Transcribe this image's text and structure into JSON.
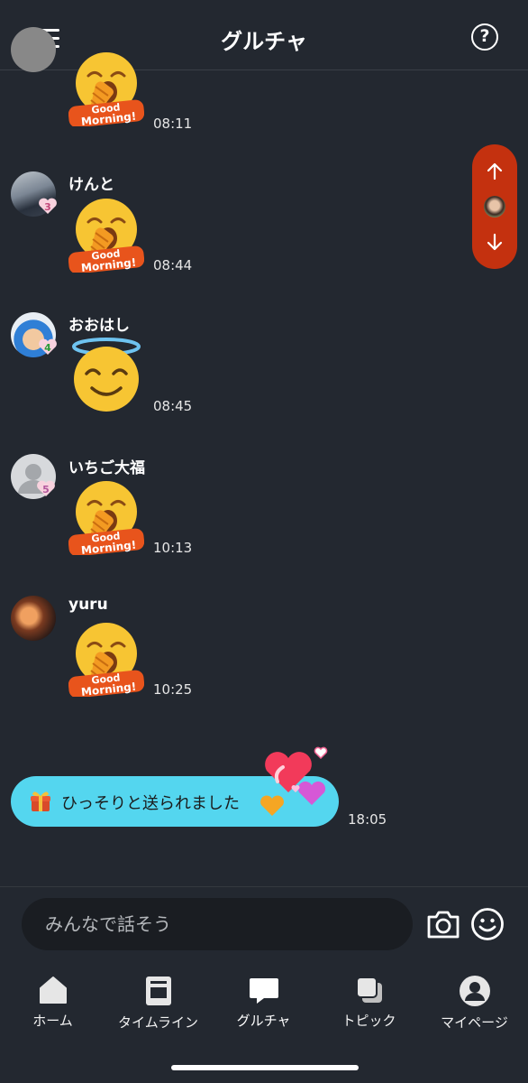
{
  "header": {
    "title": "グルチャ",
    "help_glyph": "?",
    "menu_icon": "hamburger-icon"
  },
  "messages": [
    {
      "user": "",
      "sticker": "good-morning-yawn",
      "sticker_text": "Good Morning!",
      "time": "08:11"
    },
    {
      "user": "けんと",
      "badge": "3",
      "sticker": "good-morning-yawn",
      "sticker_text": "Good Morning!",
      "time": "08:44"
    },
    {
      "user": "おおはし",
      "badge": "4",
      "sticker": "halo-smile",
      "time": "08:45"
    },
    {
      "user": "いちご大福",
      "badge": "5",
      "sticker": "good-morning-yawn",
      "sticker_text": "Good Morning!",
      "time": "10:13"
    },
    {
      "user": "yuru",
      "sticker": "good-morning-yawn",
      "sticker_text": "Good Morning!",
      "time": "10:25"
    }
  ],
  "gift_message": {
    "text": "ひっそりと送られました",
    "time": "18:05"
  },
  "input": {
    "placeholder": "みんなで話そう"
  },
  "tabs": [
    {
      "label": "ホーム",
      "icon": "home-icon"
    },
    {
      "label": "タイムライン",
      "icon": "timeline-icon"
    },
    {
      "label": "グルチャ",
      "icon": "chat-bubble-icon",
      "active": true
    },
    {
      "label": "トピック",
      "icon": "topic-icon"
    },
    {
      "label": "マイページ",
      "icon": "profile-icon"
    }
  ],
  "colors": {
    "background": "#232830",
    "scroll_nav": "#c4310f",
    "gift_pill": "#54d6ef",
    "emoji": "#f7c533",
    "sticker_banner": "#e8541c"
  }
}
